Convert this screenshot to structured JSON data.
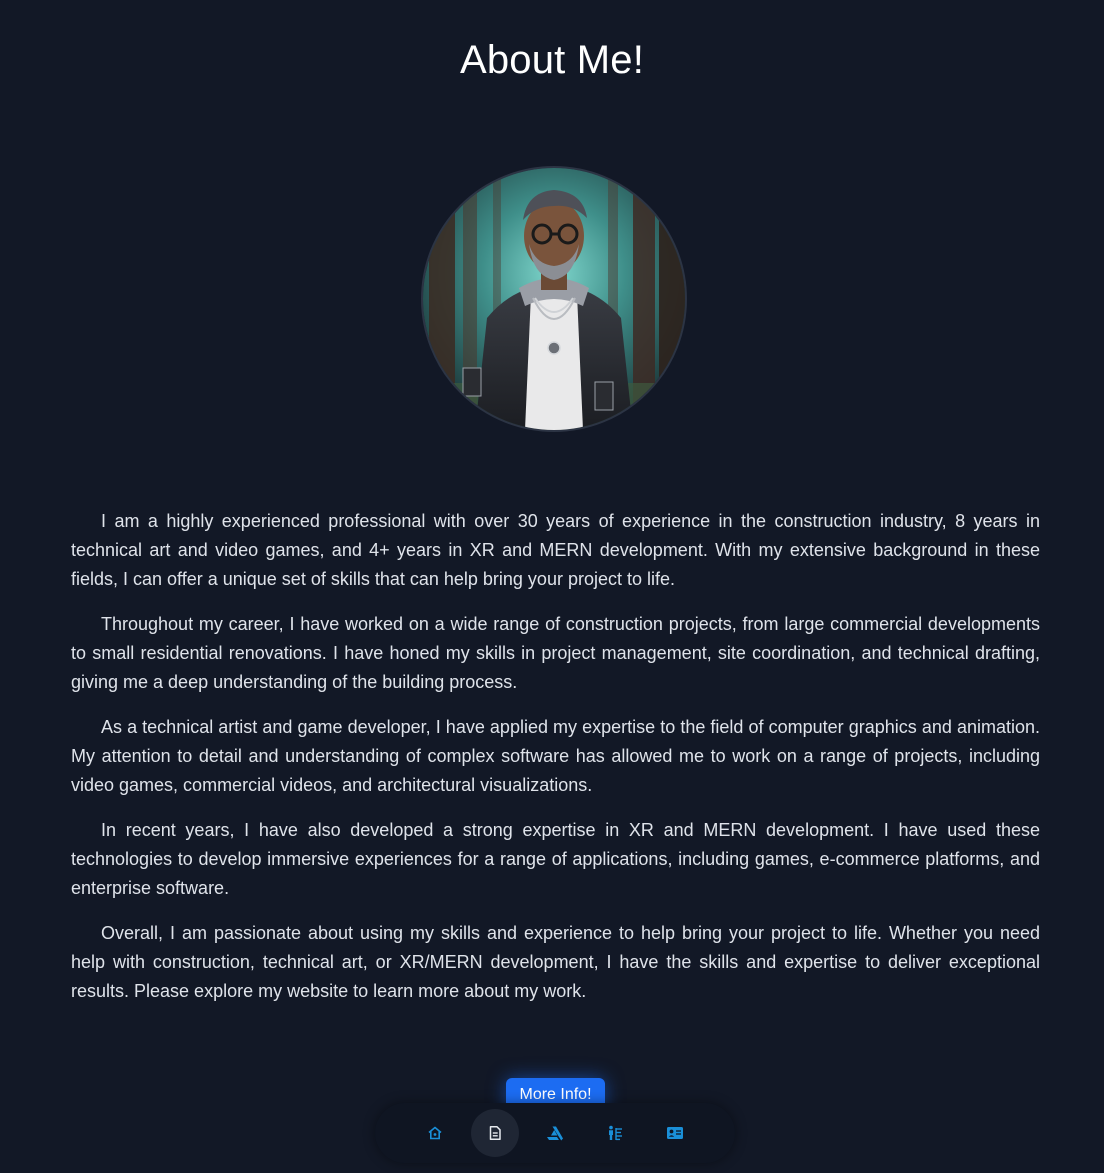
{
  "page": {
    "title": "About Me!"
  },
  "bio": {
    "paragraphs": [
      "I am a highly experienced professional with over 30 years of experience in the construction industry, 8 years in technical art and video games, and 4+ years in XR and MERN development. With my extensive background in these fields, I can offer a unique set of skills that can help bring your project to life.",
      "Throughout my career, I have worked on a wide range of construction projects, from large commercial developments to small residential renovations. I have honed my skills in project management, site coordination, and technical drafting, giving me a deep understanding of the building process.",
      "As a technical artist and game developer, I have applied my expertise to the field of computer graphics and animation. My attention to detail and understanding of complex software has allowed me to work on a range of projects, including video games, commercial videos, and architectural visualizations.",
      "In recent years, I have also developed a strong expertise in XR and MERN development. I have used these technologies to develop immersive experiences for a range of applications, including games, e-commerce platforms, and enterprise software.",
      "Overall, I am passionate about using my skills and experience to help bring your project to life. Whether you need help with construction, technical art, or XR/MERN development, I have the skills and expertise to deliver exceptional results. Please explore my website to learn more about my work."
    ]
  },
  "cta": {
    "label": "More Info!"
  },
  "dock": {
    "items": [
      {
        "icon": "home-icon",
        "active": false
      },
      {
        "icon": "document-icon",
        "active": true
      },
      {
        "icon": "artstation-icon",
        "active": false
      },
      {
        "icon": "skills-icon",
        "active": false
      },
      {
        "icon": "contact-card-icon",
        "active": false
      }
    ]
  },
  "colors": {
    "background": "#121826",
    "accent": "#1c6cf2",
    "dock_icon": "#1a8fd8"
  }
}
